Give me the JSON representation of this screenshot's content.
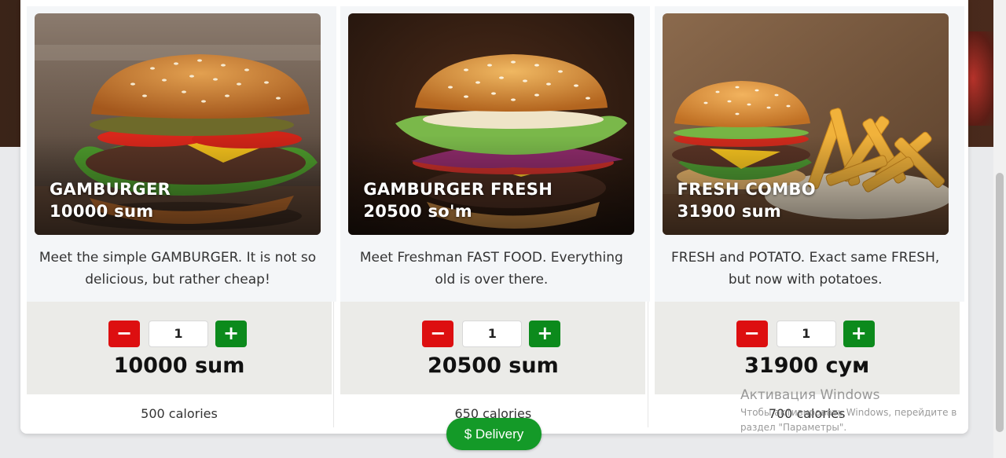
{
  "products": [
    {
      "name": "GAMBURGER",
      "overlay_price": "10000 sum",
      "description": "Meet the simple GAMBURGER. It is not so delicious, but rather cheap!",
      "quantity": "1",
      "price": "10000 sum",
      "calories": "500 calories",
      "minus_label": "−",
      "plus_label": "+"
    },
    {
      "name": "GAMBURGER FRESH",
      "overlay_price": "20500 so'm",
      "description": "Meet Freshman FAST FOOD. Everything old is over there.",
      "quantity": "1",
      "price": "20500 sum",
      "calories": "650 calories",
      "minus_label": "−",
      "plus_label": "+"
    },
    {
      "name": "FRESH COMBO",
      "overlay_price": "31900 sum",
      "description": "FRESH and POTATO. Exact same FRESH, but now with potatoes.",
      "quantity": "1",
      "price": "31900 сум",
      "calories": "700 calories",
      "minus_label": "−",
      "plus_label": "+"
    }
  ],
  "delivery_button": {
    "label": "$ Delivery"
  },
  "windows_activation": {
    "title": "Активация Windows",
    "line2": "Чтобы активировать Windows, перейдите в",
    "line3": "раздел \"Параметры\"."
  },
  "colors": {
    "minus_button": "#dd0f10",
    "plus_button": "#0c8a1c",
    "delivery_button": "#149a28",
    "order_panel": "#ebebe8"
  }
}
